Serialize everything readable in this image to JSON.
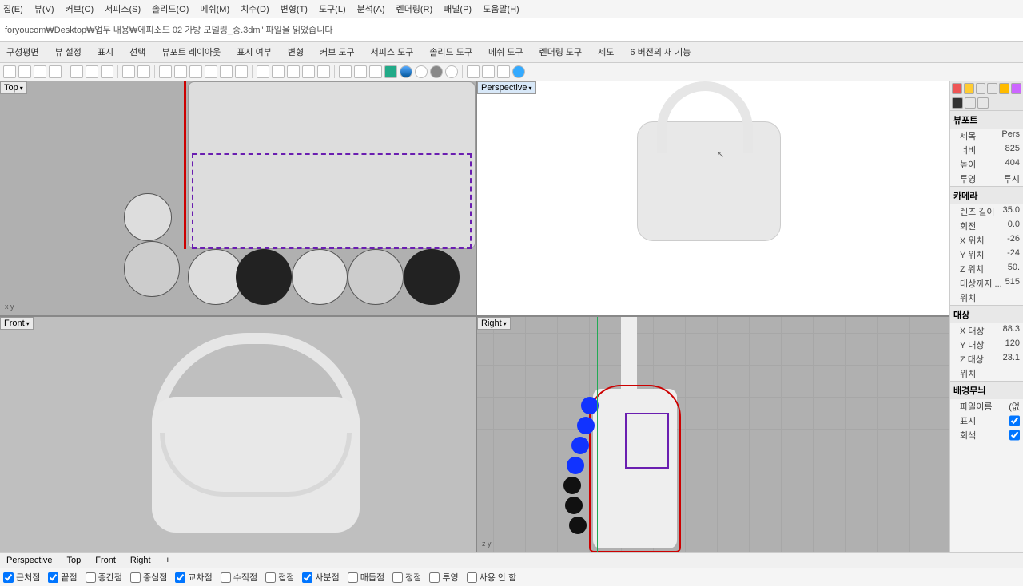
{
  "menu": {
    "items": [
      "집(E)",
      "뷰(V)",
      "커브(C)",
      "서피스(S)",
      "솔리드(O)",
      "메쉬(M)",
      "치수(D)",
      "변형(T)",
      "도구(L)",
      "분석(A)",
      "렌더링(R)",
      "패널(P)",
      "도움말(H)"
    ]
  },
  "command_line": "foryoucom₩Desktop₩업무 내용₩에피소드 02 가방 모델링_중.3dm\" 파일을 읽었습니다",
  "tool_tabs": {
    "items": [
      "구성평면",
      "뷰 설정",
      "표시",
      "선택",
      "뷰포트 레이아웃",
      "표시 여부",
      "변형",
      "커브 도구",
      "서피스 도구",
      "솔리드 도구",
      "메쉬 도구",
      "렌더링 도구",
      "제도",
      "6 버전의 새 기능"
    ]
  },
  "viewports": {
    "top": {
      "label": "Top",
      "axes": "x  y"
    },
    "perspective": {
      "label": "Perspective"
    },
    "front": {
      "label": "Front"
    },
    "right": {
      "label": "Right",
      "axes": "z  y"
    }
  },
  "panel": {
    "sections": {
      "viewport": {
        "title": "뷰포트",
        "rows": [
          {
            "k": "제목",
            "v": "Pers"
          },
          {
            "k": "너비",
            "v": "825"
          },
          {
            "k": "높이",
            "v": "404"
          },
          {
            "k": "투영",
            "v": "투시"
          }
        ]
      },
      "camera": {
        "title": "카메라",
        "rows": [
          {
            "k": "렌즈 길이",
            "v": "35.0"
          },
          {
            "k": "회전",
            "v": "0.0"
          },
          {
            "k": "X 위치",
            "v": "-26"
          },
          {
            "k": "Y 위치",
            "v": "-24"
          },
          {
            "k": "Z 위치",
            "v": "50."
          },
          {
            "k": "대상까지 ...",
            "v": "515"
          },
          {
            "k": "위치",
            "v": ""
          }
        ]
      },
      "target": {
        "title": "대상",
        "rows": [
          {
            "k": "X 대상",
            "v": "88.3"
          },
          {
            "k": "Y 대상",
            "v": "120"
          },
          {
            "k": "Z 대상",
            "v": "23.1"
          },
          {
            "k": "위치",
            "v": ""
          }
        ]
      },
      "wallpaper": {
        "title": "배경무늬",
        "rows": [
          {
            "k": "파일이름",
            "v": "(없"
          },
          {
            "k": "표시",
            "v": "[x]"
          },
          {
            "k": "회색",
            "v": "[x]"
          }
        ]
      }
    }
  },
  "bottom_tabs": {
    "items": [
      "Perspective",
      "Top",
      "Front",
      "Right",
      "+"
    ]
  },
  "osnap": {
    "items": [
      {
        "label": "근처점",
        "checked": true
      },
      {
        "label": "끝점",
        "checked": true
      },
      {
        "label": "중간점",
        "checked": false
      },
      {
        "label": "중심점",
        "checked": false
      },
      {
        "label": "교차점",
        "checked": true
      },
      {
        "label": "수직점",
        "checked": false
      },
      {
        "label": "접점",
        "checked": false
      },
      {
        "label": "사분점",
        "checked": true
      },
      {
        "label": "매듭점",
        "checked": false
      },
      {
        "label": "정점",
        "checked": false
      },
      {
        "label": "투영",
        "checked": false
      },
      {
        "label": "사용 안 함",
        "checked": false
      }
    ]
  }
}
